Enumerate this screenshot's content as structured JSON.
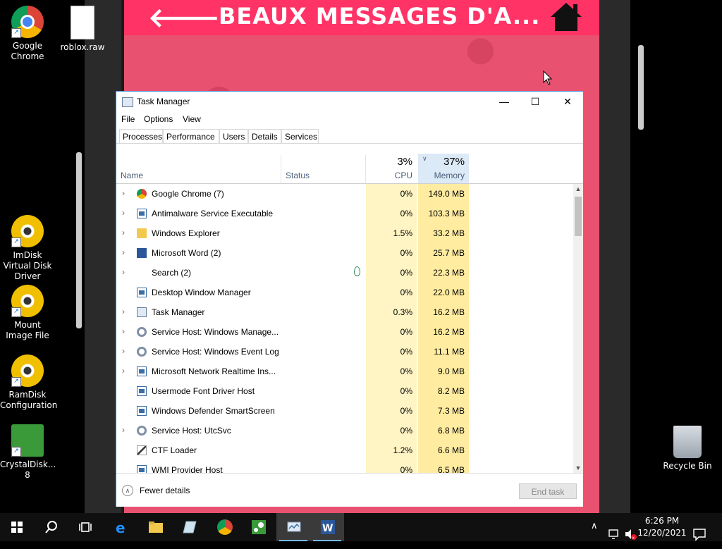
{
  "background_app": {
    "title": "BEAUX MESSAGES D'A...",
    "back_glyph": "🡐",
    "header_color": "#ff3366"
  },
  "desktop": {
    "icons": [
      {
        "label": "Google Chrome",
        "icon": "chrome-icon"
      },
      {
        "label": "roblox.raw",
        "icon": "file-icon"
      },
      {
        "label": "ImDisk Virtual Disk Driver",
        "icon": "disc-icon"
      },
      {
        "label": "Mount Image File",
        "icon": "disc-icon"
      },
      {
        "label": "RamDisk Configuration",
        "icon": "disc-icon"
      },
      {
        "label": "CrystalDisk... 8",
        "icon": "crystaldisk-icon"
      },
      {
        "label": "Recycle Bin",
        "icon": "recycle-bin-icon"
      }
    ]
  },
  "task_manager": {
    "title": "Task Manager",
    "menu": [
      "File",
      "Options",
      "View"
    ],
    "tabs": [
      "Processes",
      "Performance",
      "Users",
      "Details",
      "Services"
    ],
    "active_tab": "Processes",
    "columns": {
      "name": "Name",
      "status": "Status",
      "cpu_pct": "3%",
      "cpu_label": "CPU",
      "mem_pct": "37%",
      "mem_label": "Memory"
    },
    "processes": [
      {
        "name": "Google Chrome (7)",
        "cpu": "0%",
        "memory": "149.0 MB",
        "expandable": true,
        "icon": "chrome-icon"
      },
      {
        "name": "Antimalware Service Executable",
        "cpu": "0%",
        "memory": "103.3 MB",
        "expandable": true,
        "icon": "app-icon"
      },
      {
        "name": "Windows Explorer",
        "cpu": "1.5%",
        "memory": "33.2 MB",
        "expandable": true,
        "icon": "folder-icon"
      },
      {
        "name": "Microsoft Word (2)",
        "cpu": "0%",
        "memory": "25.7 MB",
        "expandable": true,
        "icon": "word-icon"
      },
      {
        "name": "Search (2)",
        "cpu": "0%",
        "memory": "22.3 MB",
        "expandable": true,
        "icon": "blank-icon",
        "suspended_leaf": true
      },
      {
        "name": "Desktop Window Manager",
        "cpu": "0%",
        "memory": "22.0 MB",
        "expandable": false,
        "icon": "app-icon"
      },
      {
        "name": "Task Manager",
        "cpu": "0.3%",
        "memory": "16.2 MB",
        "expandable": true,
        "icon": "taskmanager-icon"
      },
      {
        "name": "Service Host: Windows Manage...",
        "cpu": "0%",
        "memory": "16.2 MB",
        "expandable": true,
        "icon": "gear-icon"
      },
      {
        "name": "Service Host: Windows Event Log",
        "cpu": "0%",
        "memory": "11.1 MB",
        "expandable": true,
        "icon": "gear-icon"
      },
      {
        "name": "Microsoft Network Realtime Ins...",
        "cpu": "0%",
        "memory": "9.0 MB",
        "expandable": true,
        "icon": "app-icon"
      },
      {
        "name": "Usermode Font Driver Host",
        "cpu": "0%",
        "memory": "8.2 MB",
        "expandable": false,
        "icon": "app-icon"
      },
      {
        "name": "Windows Defender SmartScreen",
        "cpu": "0%",
        "memory": "7.3 MB",
        "expandable": false,
        "icon": "app-icon"
      },
      {
        "name": "Service Host: UtcSvc",
        "cpu": "0%",
        "memory": "6.8 MB",
        "expandable": true,
        "icon": "gear-icon"
      },
      {
        "name": "CTF Loader",
        "cpu": "1.2%",
        "memory": "6.6 MB",
        "expandable": false,
        "icon": "pen-icon"
      },
      {
        "name": "WMI Provider Host",
        "cpu": "0%",
        "memory": "6.5 MB",
        "expandable": false,
        "icon": "app-icon"
      }
    ],
    "footer": {
      "fewer_details": "Fewer details",
      "end_task": "End task"
    }
  },
  "taskbar": {
    "clock_time": "6:26 PM",
    "clock_date": "12/20/2021",
    "accent": "#76b9ed"
  }
}
